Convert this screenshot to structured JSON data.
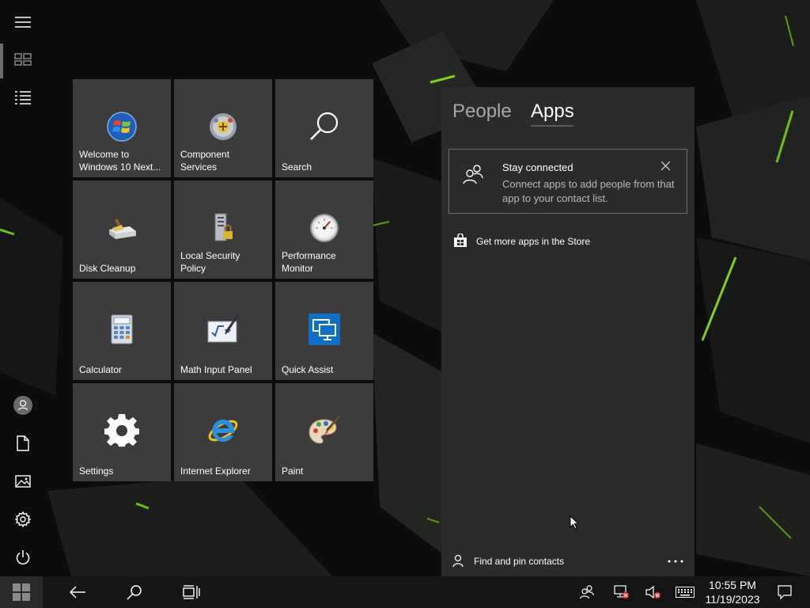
{
  "rail": {
    "items": [
      {
        "name": "expand-menu",
        "icon": "hamburger-icon"
      },
      {
        "name": "pinned-tiles",
        "icon": "tiles-icon"
      },
      {
        "name": "all-apps",
        "icon": "list-icon"
      },
      {
        "name": "user-account",
        "icon": "user-avatar-icon"
      },
      {
        "name": "documents",
        "icon": "document-icon"
      },
      {
        "name": "pictures",
        "icon": "pictures-icon"
      },
      {
        "name": "settings",
        "icon": "gear-icon"
      },
      {
        "name": "power",
        "icon": "power-icon"
      }
    ]
  },
  "tiles": [
    {
      "label": "Welcome to\nWindows 10 Next...",
      "icon": "windows-logo-icon"
    },
    {
      "label": "Component\nServices",
      "icon": "component-services-icon"
    },
    {
      "label": "Search",
      "icon": "search-icon"
    },
    {
      "label": "Disk Cleanup",
      "icon": "disk-cleanup-icon"
    },
    {
      "label": "Local Security Policy",
      "icon": "security-policy-icon"
    },
    {
      "label": "Performance\nMonitor",
      "icon": "gauge-icon"
    },
    {
      "label": "Calculator",
      "icon": "calculator-icon"
    },
    {
      "label": "Math Input Panel",
      "icon": "math-input-icon"
    },
    {
      "label": "Quick Assist",
      "icon": "quick-assist-icon"
    },
    {
      "label": "Settings",
      "icon": "gear-icon"
    },
    {
      "label": "Internet Explorer",
      "icon": "internet-explorer-icon"
    },
    {
      "label": "Paint",
      "icon": "paint-palette-icon"
    }
  ],
  "people": {
    "tabs": [
      {
        "label": "People",
        "active": false
      },
      {
        "label": "Apps",
        "active": true
      }
    ],
    "notice": {
      "title": "Stay connected",
      "body": "Connect apps to add people from that app to your contact list."
    },
    "store_link": "Get more apps in the Store",
    "find_contacts": "Find and pin contacts",
    "more_label": "···"
  },
  "taskbar": {
    "time": "10:55 PM",
    "date": "11/19/2023",
    "icons": [
      "start-icon",
      "back-arrow-icon",
      "search-icon",
      "task-view-icon",
      "people-icon",
      "network-error-icon",
      "volume-muted-icon",
      "keyboard-icon",
      "notifications-icon"
    ]
  },
  "colors": {
    "tile_bg": "#3c3c3c",
    "panel_bg": "#2b2b2b",
    "taskbar_bg": "#151515",
    "accent_green": "#7fd11b"
  }
}
